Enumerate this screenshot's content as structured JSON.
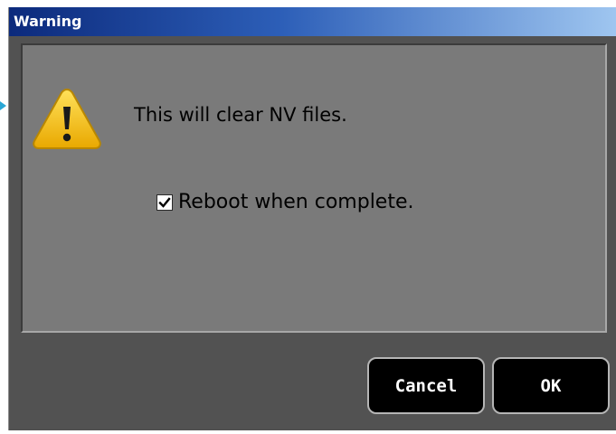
{
  "window": {
    "title": "Warning"
  },
  "message": {
    "text": "This will clear NV files.",
    "icon": "warning-triangle-icon"
  },
  "reboot_option": {
    "label": "Reboot when complete.",
    "checked": true
  },
  "buttons": {
    "cancel_label": "Cancel",
    "ok_label": "OK"
  },
  "colors": {
    "titlebar_start": "#0c2a7c",
    "titlebar_end": "#9fc6f0",
    "dialog_bg": "#525252",
    "panel_bg": "#7a7a7a",
    "button_bg": "#000000",
    "warning_yellow": "#f2c200"
  }
}
